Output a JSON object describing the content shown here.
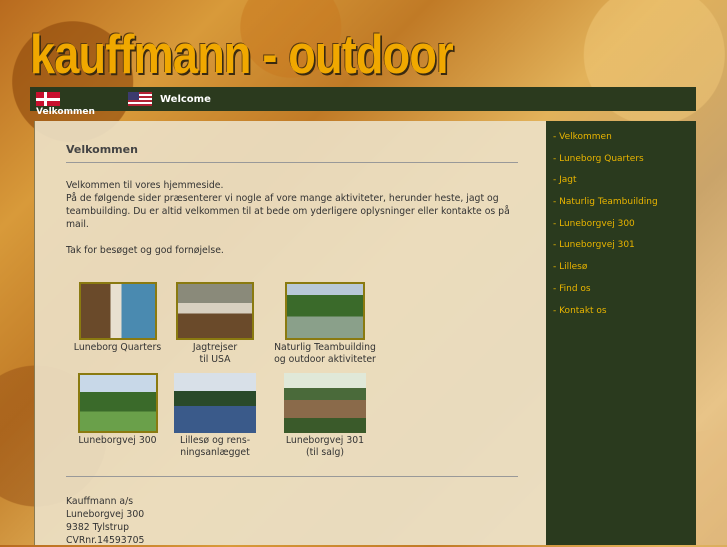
{
  "header": {
    "logo": "kauffmann - outdoor"
  },
  "languages": [
    {
      "label": "Velkommen",
      "flag": "denmark-flag-icon"
    },
    {
      "label": "Welcome",
      "flag": "usa-flag-icon"
    }
  ],
  "main": {
    "title": "Velkommen",
    "intro": [
      "Velkommen til vores hjemmeside.",
      "På de følgende sider præsenterer vi nogle af vore mange aktiviteter, herunder heste, jagt og teambuilding. Du er altid velkommen til at bede om yderligere oplysninger eller kontakte os på mail.",
      "Tak for besøget og god fornøjelse."
    ],
    "thumbs": [
      {
        "line1": "Luneborg Quarters",
        "line2": ""
      },
      {
        "line1": "Jagtrejser",
        "line2": "til USA"
      },
      {
        "line1": "Naturlig Teambuilding",
        "line2": "og outdoor aktiviteter"
      },
      {
        "line1": "Luneborgvej 300",
        "line2": ""
      },
      {
        "line1": "Lillesø og rens-",
        "line2": "ningsanlægget"
      },
      {
        "line1": "Luneborgvej 301",
        "line2": "(til salg)"
      }
    ],
    "address": [
      "Kauffmann a/s",
      "Luneborgvej 300",
      "9382 Tylstrup",
      "CVRnr.14593705"
    ]
  },
  "sidebar": {
    "items": [
      "- Velkommen",
      "- Luneborg Quarters",
      "- Jagt",
      "- Naturlig Teambuilding",
      "- Luneborgvej 300",
      "- Luneborgvej 301",
      "- Lillesø",
      "- Find os",
      "- Kontakt os"
    ]
  },
  "colors": {
    "logo": "#f0a800",
    "nav_bg": "#2b3a1e",
    "link": "#e8b400"
  }
}
